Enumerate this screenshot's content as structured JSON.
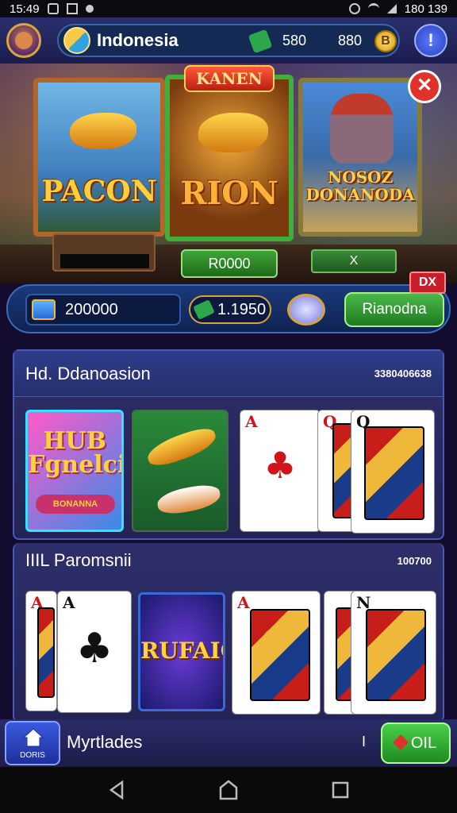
{
  "status_bar": {
    "time": "15:49",
    "right_text": "180 139"
  },
  "header": {
    "region": "Indonesia",
    "green_value": "580",
    "gold_value": "880",
    "gold_coin_symbol": "B",
    "info_symbol": "!"
  },
  "featured": {
    "banner": "KANEN",
    "close_symbol": "✕",
    "cards": [
      {
        "title": "PACON"
      },
      {
        "title": "RION",
        "button": "R0000"
      },
      {
        "title": "NOSOZ DONANODA",
        "button": "X"
      }
    ]
  },
  "action_bar": {
    "balance": "200000",
    "cash": "1.1950",
    "play_label": "Rianodna",
    "badge": "DX"
  },
  "panel_top": {
    "title": "Hd.  Ddanoasion",
    "count": "3380406638",
    "hub_title": "HUB Fgnelci",
    "hub_ribbon": "BONANNA",
    "card1_rank": "A",
    "card2_rank": "Q",
    "card3_rank": "Q"
  },
  "panel_bottom": {
    "title": "IIIL  Paromsnii",
    "count": "100700",
    "card1_rank": "A",
    "card2_rank": "A",
    "rurtic_title": "RUFAIC",
    "card3_rank": "A",
    "card4_rank": "N"
  },
  "bottom_row": {
    "home_label": "DORIS",
    "title": "Myrtlades",
    "separator": "I",
    "ok_label": "OIL"
  }
}
